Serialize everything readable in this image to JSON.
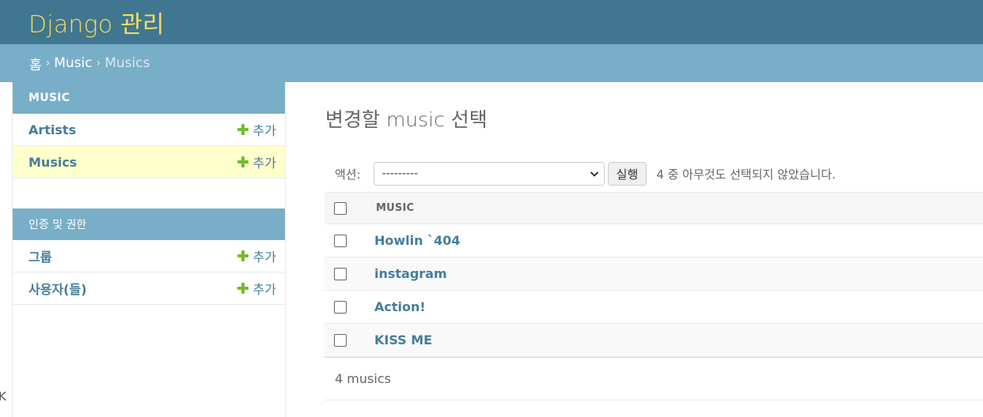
{
  "header": {
    "site_name": "Django 관리"
  },
  "breadcrumbs": {
    "home": "홈",
    "separator": "›",
    "app": "Music",
    "current": "Musics"
  },
  "left_edge": {
    "mark": "K"
  },
  "sidebar": {
    "modules": [
      {
        "caption": "MUSIC",
        "models": [
          {
            "name": "Artists",
            "add": "추가",
            "current": false
          },
          {
            "name": "Musics",
            "add": "추가",
            "current": true
          }
        ]
      },
      {
        "caption": "인증 및 권한",
        "models": [
          {
            "name": "그룹",
            "add": "추가",
            "current": false
          },
          {
            "name": "사용자(들)",
            "add": "추가",
            "current": false
          }
        ]
      }
    ]
  },
  "content": {
    "title": "변경할 music 선택",
    "actions": {
      "label": "액션:",
      "selected": "---------",
      "run": "실행",
      "counter": "4 중 아무것도 선택되지 않았습니다."
    },
    "table": {
      "column": "MUSIC",
      "rows": [
        "Howlin `404",
        "instagram",
        "Action!",
        "KISS ME"
      ]
    },
    "paginator": "4 musics"
  },
  "colors": {
    "header_bg": "#417690",
    "site_name": "#f5dd5d",
    "module_bg": "#79aec8",
    "link": "#447e9b",
    "current_row": "#ffffcc",
    "add_icon": "#70bf2b"
  }
}
